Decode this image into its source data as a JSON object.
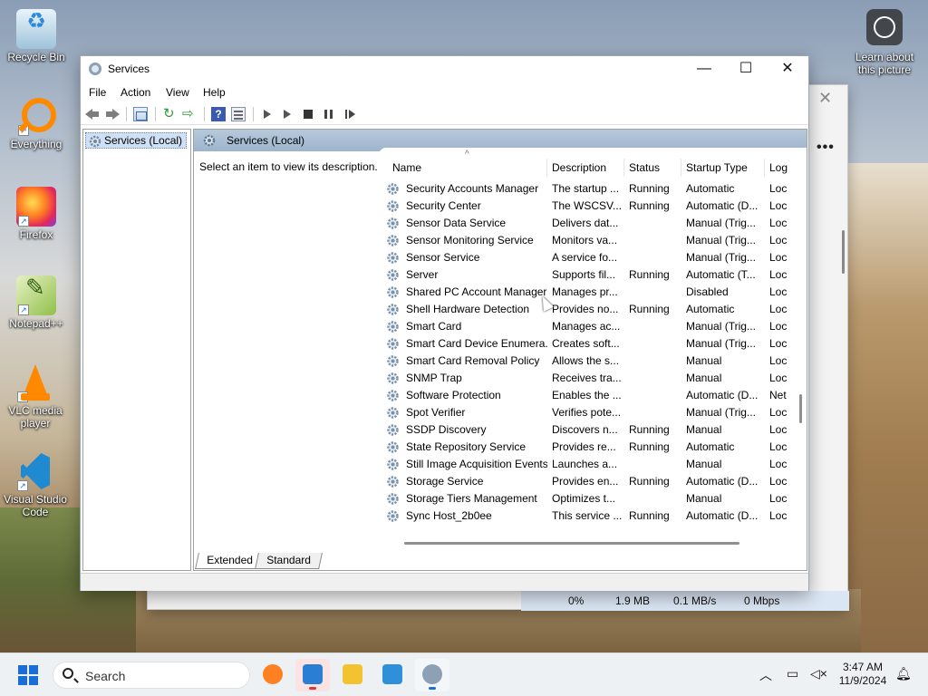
{
  "desktop": {
    "icons": [
      {
        "label": "Recycle Bin",
        "icon": "recycle-bin-icon"
      },
      {
        "label": "Everything",
        "icon": "everything-search-icon"
      },
      {
        "label": "Firefox",
        "icon": "firefox-icon"
      },
      {
        "label": "Notepad++",
        "icon": "notepad-plus-plus-icon"
      },
      {
        "label": "VLC media player",
        "icon": "vlc-icon"
      },
      {
        "label": "Visual Studio Code",
        "icon": "vscode-icon"
      }
    ],
    "learn_label": "Learn about this picture"
  },
  "bg_window": {
    "cpu": "0%",
    "memory": "1.9 MB",
    "disk": "0.1 MB/s",
    "network": "0 Mbps"
  },
  "window": {
    "title": "Services",
    "controls": {
      "minimize": "—",
      "maximize": "☐",
      "close": "✕"
    },
    "menu": [
      "File",
      "Action",
      "View",
      "Help"
    ],
    "tree_item": "Services (Local)",
    "pane_title": "Services (Local)",
    "description_hint": "Select an item to view its description.",
    "columns": [
      "Name",
      "Description",
      "Status",
      "Startup Type",
      "Log"
    ],
    "sort_indicator": "^",
    "tabs": [
      "Extended",
      "Standard"
    ],
    "help_glyph": "?"
  },
  "services": [
    {
      "name": "Security Accounts Manager",
      "description": "The startup ...",
      "status": "Running",
      "startup": "Automatic",
      "logon": "Loc"
    },
    {
      "name": "Security Center",
      "description": "The WSCSV...",
      "status": "Running",
      "startup": "Automatic (D...",
      "logon": "Loc"
    },
    {
      "name": "Sensor Data Service",
      "description": "Delivers dat...",
      "status": "",
      "startup": "Manual (Trig...",
      "logon": "Loc"
    },
    {
      "name": "Sensor Monitoring Service",
      "description": "Monitors va...",
      "status": "",
      "startup": "Manual (Trig...",
      "logon": "Loc"
    },
    {
      "name": "Sensor Service",
      "description": "A service fo...",
      "status": "",
      "startup": "Manual (Trig...",
      "logon": "Loc"
    },
    {
      "name": "Server",
      "description": "Supports fil...",
      "status": "Running",
      "startup": "Automatic (T...",
      "logon": "Loc"
    },
    {
      "name": "Shared PC Account Manager",
      "description": "Manages pr...",
      "status": "",
      "startup": "Disabled",
      "logon": "Loc"
    },
    {
      "name": "Shell Hardware Detection",
      "description": "Provides no...",
      "status": "Running",
      "startup": "Automatic",
      "logon": "Loc"
    },
    {
      "name": "Smart Card",
      "description": "Manages ac...",
      "status": "",
      "startup": "Manual (Trig...",
      "logon": "Loc"
    },
    {
      "name": "Smart Card Device Enumera...",
      "description": "Creates soft...",
      "status": "",
      "startup": "Manual (Trig...",
      "logon": "Loc"
    },
    {
      "name": "Smart Card Removal Policy",
      "description": "Allows the s...",
      "status": "",
      "startup": "Manual",
      "logon": "Loc"
    },
    {
      "name": "SNMP Trap",
      "description": "Receives tra...",
      "status": "",
      "startup": "Manual",
      "logon": "Loc"
    },
    {
      "name": "Software Protection",
      "description": "Enables the ...",
      "status": "",
      "startup": "Automatic (D...",
      "logon": "Net"
    },
    {
      "name": "Spot Verifier",
      "description": "Verifies pote...",
      "status": "",
      "startup": "Manual (Trig...",
      "logon": "Loc"
    },
    {
      "name": "SSDP Discovery",
      "description": "Discovers n...",
      "status": "Running",
      "startup": "Manual",
      "logon": "Loc"
    },
    {
      "name": "State Repository Service",
      "description": "Provides re...",
      "status": "Running",
      "startup": "Automatic",
      "logon": "Loc"
    },
    {
      "name": "Still Image Acquisition Events",
      "description": "Launches a...",
      "status": "",
      "startup": "Manual",
      "logon": "Loc"
    },
    {
      "name": "Storage Service",
      "description": "Provides en...",
      "status": "Running",
      "startup": "Automatic (D...",
      "logon": "Loc"
    },
    {
      "name": "Storage Tiers Management",
      "description": "Optimizes t...",
      "status": "",
      "startup": "Manual",
      "logon": "Loc"
    },
    {
      "name": "Sync Host_2b0ee",
      "description": "This service ...",
      "status": "Running",
      "startup": "Automatic (D...",
      "logon": "Loc"
    }
  ],
  "taskbar": {
    "search_placeholder": "Search",
    "apps": [
      {
        "name": "firefox-taskbar-icon",
        "color": "#ff7f23"
      },
      {
        "name": "app-taskbar-icon",
        "color": "#2a7fd4"
      },
      {
        "name": "file-explorer-taskbar-icon",
        "color": "#f2c230"
      },
      {
        "name": "photos-taskbar-icon",
        "color": "#2f8fd8"
      },
      {
        "name": "services-taskbar-icon",
        "color": "#8da1b5"
      }
    ],
    "time": "3:47 AM",
    "date": "11/9/2024"
  }
}
